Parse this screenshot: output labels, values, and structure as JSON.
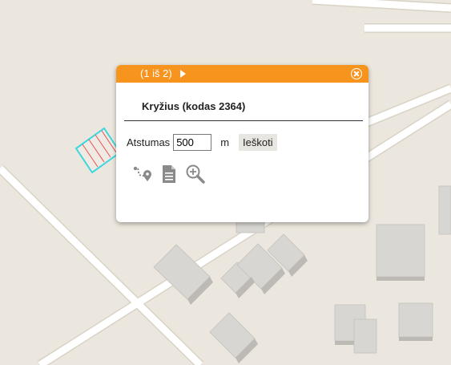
{
  "popup": {
    "pager": "(1 iš 2)",
    "title": "Kryžius (kodas 2364)",
    "distance_label": "Atstumas",
    "distance_value": "500",
    "unit": "m",
    "search_button": "Ieškoti"
  },
  "colors": {
    "header": "#f7941d",
    "feature_outline": "#3ed6de",
    "feature_hatch": "#e85050"
  },
  "tool_icons": [
    "route-icon",
    "document-icon",
    "zoom-in-icon"
  ]
}
